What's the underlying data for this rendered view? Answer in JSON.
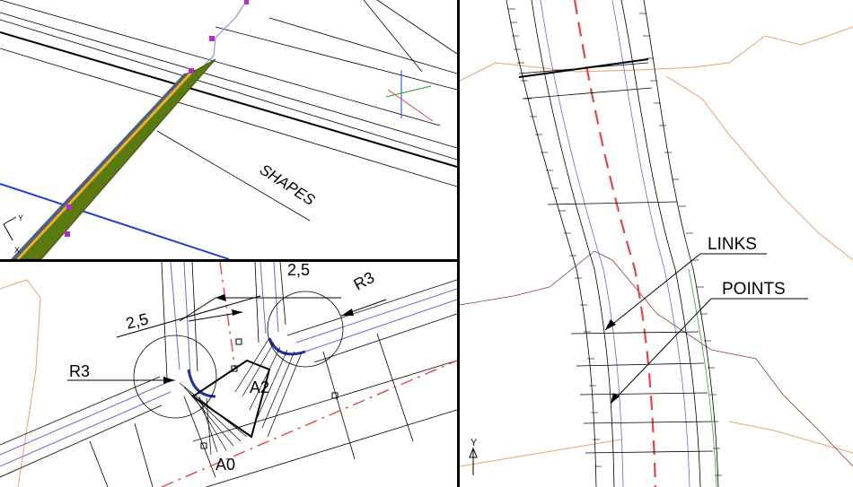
{
  "viewport_3d": {
    "shapes_label": "SHAPES",
    "ucs": {
      "y": "Y",
      "x": "X"
    }
  },
  "viewport_plan": {
    "dim_left_offset": "2,5",
    "dim_right_offset": "2,5",
    "radius_left": "R3",
    "radius_right": "R3",
    "point_a0": "A0",
    "point_a2": "A2"
  },
  "viewport_right": {
    "links_label": "LINKS",
    "points_label": "POINTS",
    "ucs_y": "Y"
  },
  "colors": {
    "background": "#ffffff",
    "divider": "#000000",
    "road_centerline": "#e04848",
    "terrain_contour": "#e8a070",
    "shape_fill": "#5a7a10",
    "shape_edge": "#f0b020",
    "blue_line": "#1f3fd0",
    "vertex_marker": "#b030c0"
  }
}
